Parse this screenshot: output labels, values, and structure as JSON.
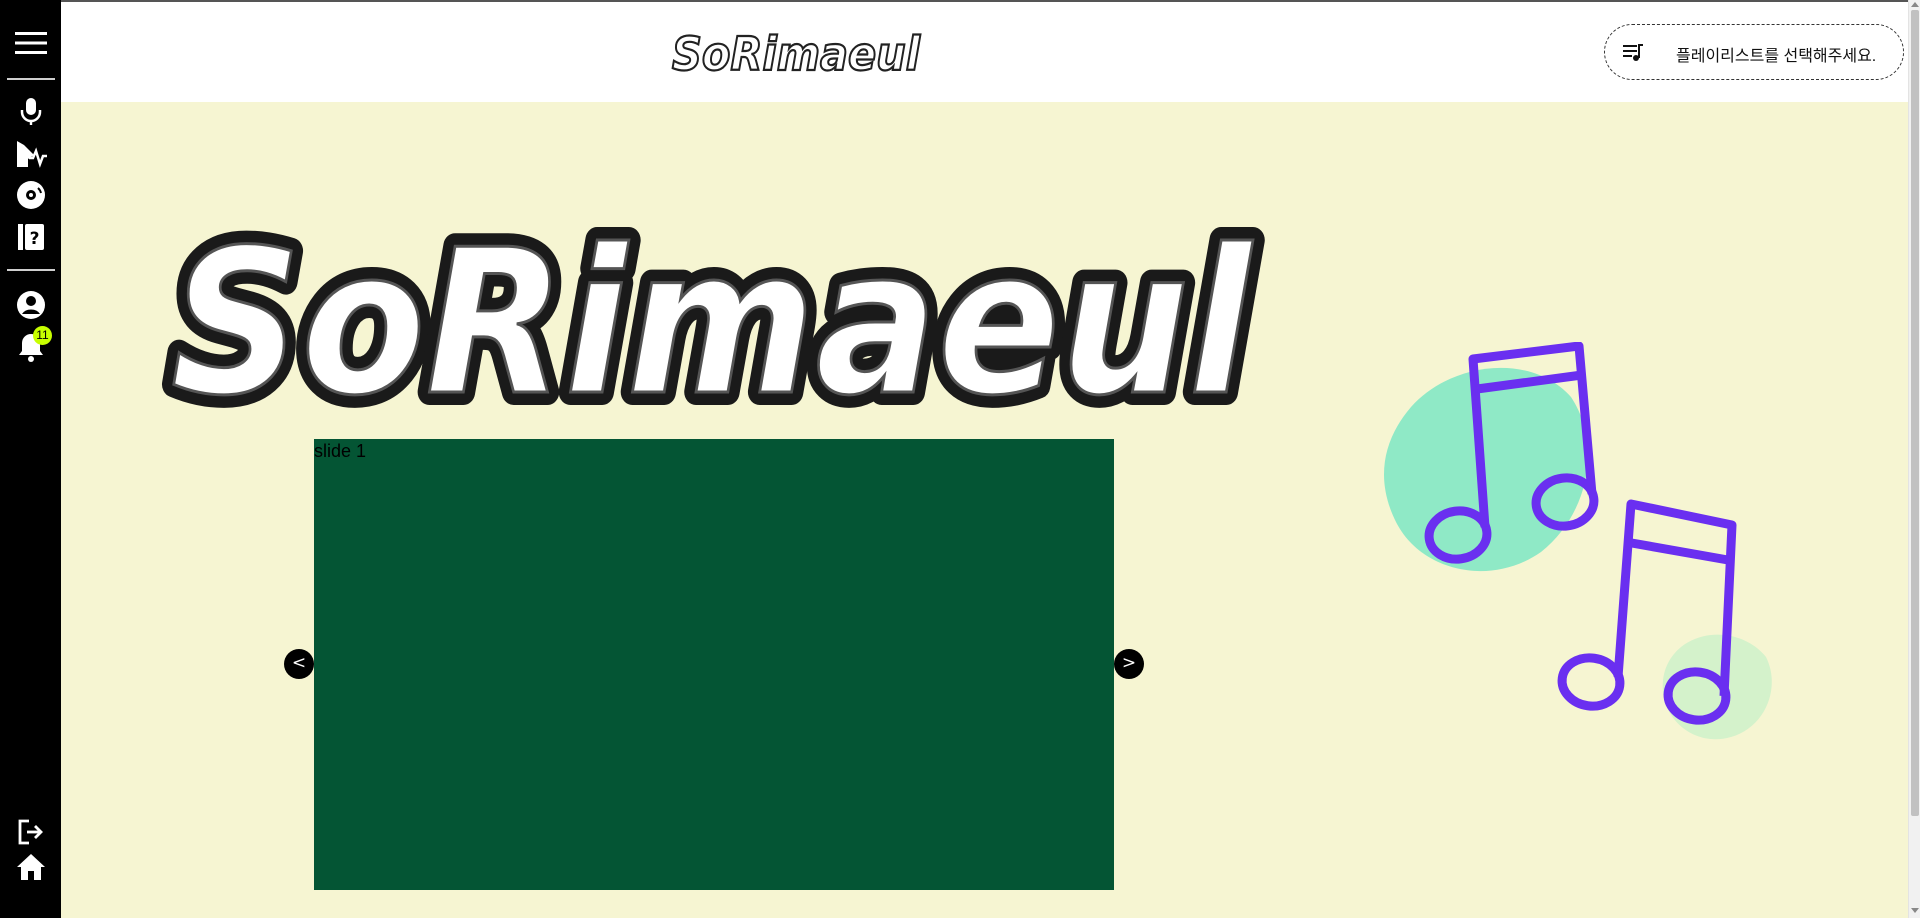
{
  "header": {
    "logo_text": "SoRimaeul",
    "playlist_prompt": "플레이리스트를 선택해주세요."
  },
  "sidebar": {
    "icons": [
      "menu-icon",
      "microphone-icon",
      "voice-analysis-icon",
      "record-disc-icon",
      "quiz-book-icon",
      "user-icon",
      "bell-icon",
      "logout-icon",
      "home-icon"
    ],
    "notification_count": "11"
  },
  "hero": {
    "logo_text": "SoRimaeul"
  },
  "slider": {
    "slide_label": "slide 1",
    "prev_label": "<",
    "next_label": ">",
    "slide_color": "#045534"
  },
  "colors": {
    "background": "#f6f5d2",
    "note_purple": "#6a2ff0",
    "blob_mint": "#8fe9c6",
    "blob_light_green": "#d4f2cb",
    "sidebar": "#000000",
    "badge": "#c8ff00"
  }
}
